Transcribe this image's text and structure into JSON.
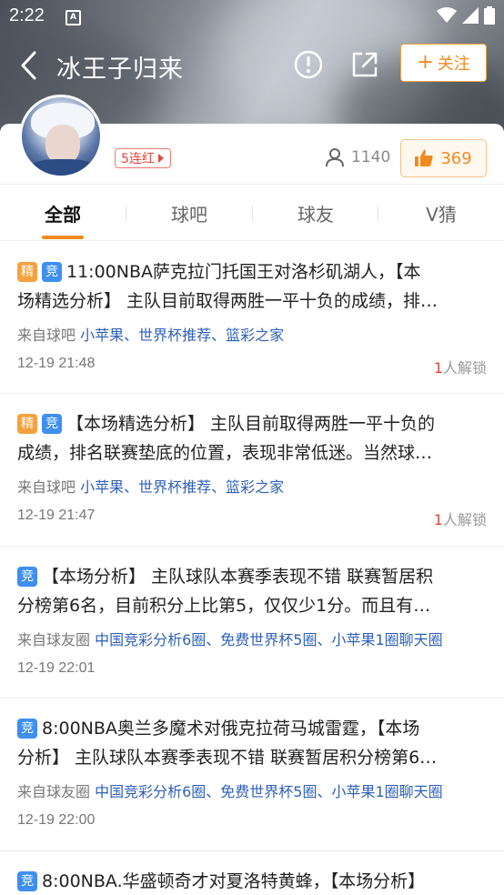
{
  "status_bar": {
    "time": "2:22"
  },
  "header": {
    "title": "冰王子归来",
    "follow_label": "关注",
    "follow_plus": "+"
  },
  "profile": {
    "streak_badge": "5连红",
    "fans_count": "1140",
    "likes_count": "369"
  },
  "tabs": [
    {
      "label": "全部",
      "active": true
    },
    {
      "label": "球吧",
      "active": false
    },
    {
      "label": "球友",
      "active": false
    },
    {
      "label": "V猜",
      "active": false
    }
  ],
  "posts": [
    {
      "tags": [
        "精",
        "竞"
      ],
      "line1": "11:00NBA萨克拉门托国王对洛杉矶湖人，【本",
      "line2": "场精选分析】 主队目前取得两胜一平十负的成绩，排…",
      "source_prefix": "来自球吧",
      "source_links": "小苹果、世界杯推荐、篮彩之家",
      "time": "12-19 21:48",
      "unlock_count": "1",
      "unlock_suffix": "人解锁"
    },
    {
      "tags": [
        "精",
        "竞"
      ],
      "line1": "【本场精选分析】 主队目前取得两胜一平十负的",
      "line2": "成绩，排名联赛垫底的位置，表现非常低迷。当然球…",
      "source_prefix": "来自球吧",
      "source_links": "小苹果、世界杯推荐、篮彩之家",
      "time": "12-19 21:47",
      "unlock_count": "1",
      "unlock_suffix": "人解锁"
    },
    {
      "tags": [
        "竞"
      ],
      "line1": "【本场分析】 主队球队本赛季表现不错 联赛暂居积",
      "line2": "分榜第6名，目前积分上比第5，仅仅少1分。而且有…",
      "source_prefix": "来自球友圈",
      "source_links": "中国竞彩分析6圈、免费世界杯5圈、小苹果1圈聊天圈",
      "time": "12-19 22:01",
      "unlock_count": "",
      "unlock_suffix": ""
    },
    {
      "tags": [
        "竞"
      ],
      "line1": "8:00NBA奥兰多魔术对俄克拉荷马城雷霆，【本场",
      "line2": "分析】 主队球队本赛季表现不错 联赛暂居积分榜第6…",
      "source_prefix": "来自球友圈",
      "source_links": "中国竞彩分析6圈、免费世界杯5圈、小苹果1圈聊天圈",
      "time": "12-19 22:00",
      "unlock_count": "",
      "unlock_suffix": ""
    },
    {
      "tags": [
        "竞"
      ],
      "line1": "8:00NBA.华盛顿奇才对夏洛特黄蜂，【本场分析】",
      "line2": "",
      "source_prefix": "",
      "source_links": "",
      "time": "",
      "unlock_count": "",
      "unlock_suffix": ""
    }
  ],
  "colors": {
    "accent": "#f08a1e",
    "link": "#2f61b8",
    "tag_jing": "#f3a23f",
    "tag_jingcai": "#3e8ff0",
    "red": "#e5473a"
  },
  "icons": {
    "back": "chevron-left-icon",
    "report": "alert-circle-icon",
    "share": "share-icon",
    "fans": "user-icon",
    "like": "thumbs-up-icon"
  }
}
